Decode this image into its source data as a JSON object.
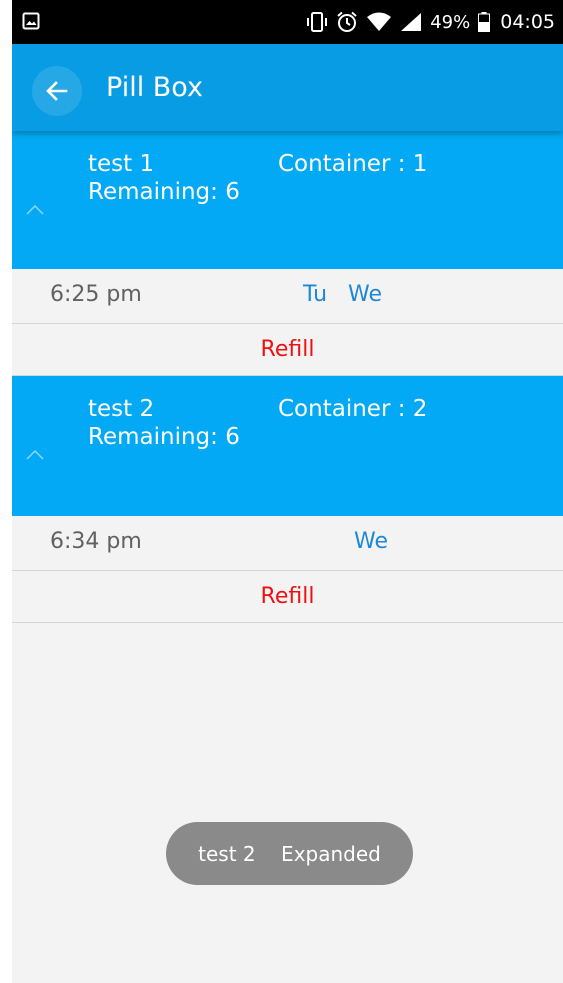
{
  "status_bar": {
    "battery_percent": "49%",
    "time": "04:05",
    "icons": [
      "gallery-icon",
      "vibrate-icon",
      "alarm-icon",
      "wifi-icon",
      "signal-icon",
      "battery-icon"
    ]
  },
  "app_bar": {
    "title": "Pill Box",
    "back_icon": "arrow-left-icon"
  },
  "medications": [
    {
      "name": "test 1",
      "container": "Container : 1",
      "remaining": "Remaining: 6",
      "schedule_time": "6:25 pm",
      "schedule_days": "Tu   We",
      "refill_label": "Refill"
    },
    {
      "name": "test 2",
      "container": "Container : 2",
      "remaining": "Remaining: 6",
      "schedule_time": "6:34 pm",
      "schedule_days": "We",
      "refill_label": "Refill"
    }
  ],
  "toast": {
    "text": "test 2    Expanded"
  },
  "colors": {
    "app_bar": "#089ce4",
    "card_header": "#03a9f4",
    "days": "#1e88d6",
    "refill": "#ee1111",
    "background": "#f3f3f3"
  }
}
